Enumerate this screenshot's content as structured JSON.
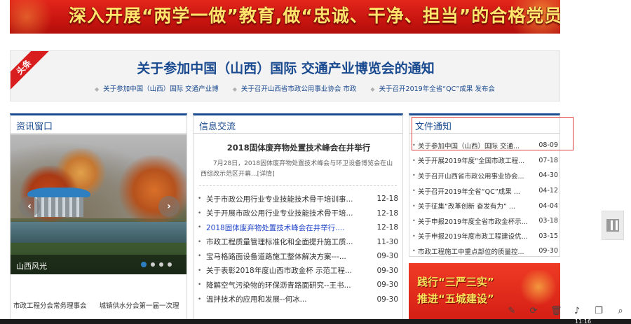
{
  "banner": {
    "text": "深入开展“两学一做”教育,做“忠诚、干净、担当”的合格党员"
  },
  "headline": {
    "ribbon": "头条",
    "title": "关于参加中国（山西）国际 交通产业博览会的通知",
    "links": [
      "关于参加中国（山西）国际 交通产业博",
      "关于召开山西省市政公用事业协会 市政",
      "关于召开2019年全省“QC”成果 发布会"
    ]
  },
  "left_panel": {
    "title": "资讯窗口",
    "slide_caption": "山西风光",
    "bottom_items": [
      "市政工程分会常务理事会",
      "城镇供水分会第一届一次理"
    ]
  },
  "mid_panel": {
    "title": "信息交流",
    "feature_title": "2018固体废弃物处置技术峰会在井举行",
    "feature_desc": "7月28日，2018固体废弃物处置技术峰会与环卫设备博览会在山西综改示范区开幕...[详情]",
    "list": [
      {
        "text": "关于市政公用行业专业技能技术骨干培训事...",
        "date": "12-18"
      },
      {
        "text": "关于开展市政公用行业专业技能技术骨干培...",
        "date": "12-18"
      },
      {
        "text": "2018固体废弃物处置技术峰会在井举行....",
        "date": "12-18"
      },
      {
        "text": "市政工程质量管理标准化和全面提升施工质...",
        "date": "11-30"
      },
      {
        "text": "宝马格路面设备道路施工整体解决方案---...",
        "date": "09-30"
      },
      {
        "text": "关于表彰2018年度山西市政金杯 示范工程...",
        "date": "09-30"
      },
      {
        "text": "降解空气污染物的环保沥青路面研究--王书...",
        "date": "09-30"
      },
      {
        "text": "温拌技术的应用和发展--何冰...",
        "date": "09-30"
      }
    ]
  },
  "right_panel": {
    "title": "文件通知",
    "list": [
      {
        "text": "关于参加中国（山西）国际 交通...",
        "date": "08-09"
      },
      {
        "text": "关于开展2019年度“全国市政工程...",
        "date": "07-18"
      },
      {
        "text": "关于召开山西省市政公用事业协会...",
        "date": "04-30"
      },
      {
        "text": "关于召开2019年全省“QC”成果 ...",
        "date": "04-12"
      },
      {
        "text": "关于征集“改革创新 奋发有为” ...",
        "date": "04-04"
      },
      {
        "text": "关于申报2019年度全省市政金杯示...",
        "date": "03-18"
      },
      {
        "text": "关于申报2019年度市政工程建设优...",
        "date": "03-15"
      },
      {
        "text": "市政工程施工中重点部位的质量控...",
        "date": "09-30"
      }
    ]
  },
  "red_banner": {
    "line1": "践行“三严三实”",
    "line2": "推进“五城建设”"
  },
  "system": {
    "clock": "11:16"
  }
}
